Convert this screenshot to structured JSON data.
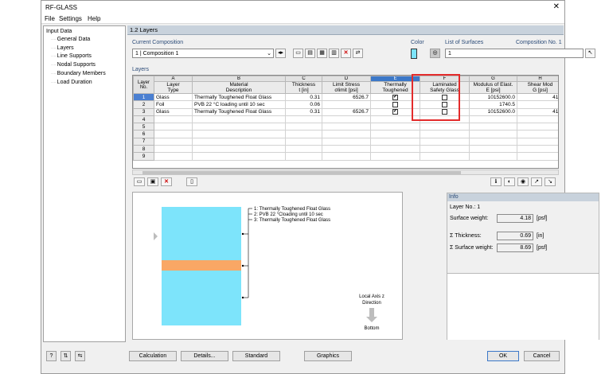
{
  "window": {
    "title": "RF-GLASS",
    "close": "✕"
  },
  "menu": {
    "file": "File",
    "settings": "Settings",
    "help": "Help"
  },
  "nav": {
    "root": "Input Data",
    "items": [
      "General Data",
      "Layers",
      "Line Supports",
      "Nodal Supports",
      "Boundary Members",
      "Load Duration"
    ]
  },
  "section_title": "1.2 Layers",
  "composition": {
    "label": "Current Composition",
    "value": "1 | Composition 1"
  },
  "color": {
    "label": "Color"
  },
  "surfaces": {
    "label": "List of Surfaces",
    "value": "1",
    "composition_no": "Composition No. 1"
  },
  "layers_label": "Layers",
  "grid": {
    "letters": [
      "A",
      "B",
      "C",
      "D",
      "E",
      "F",
      "G",
      "H"
    ],
    "headers": {
      "layer": [
        "Layer",
        "No."
      ],
      "a": [
        "Layer",
        "Type"
      ],
      "b": [
        "Material",
        "Description"
      ],
      "c": [
        "Thickness",
        "t [in]"
      ],
      "d": [
        "Limit Stress",
        "σlimit [psi]"
      ],
      "e": [
        "Thermally",
        "Toughened"
      ],
      "f": [
        "Laminated",
        "Safety Glass"
      ],
      "g": [
        "Modulus of Elast.",
        "E [psi]"
      ],
      "h": [
        "Shear Mod",
        "G [psi]"
      ]
    },
    "rows": [
      {
        "no": "1",
        "type": "Glass",
        "material": "Thermally Toughened Float Glass",
        "t": "0.31",
        "s": "6526.7",
        "tt": "✔",
        "lsg": "",
        "e": "10152600.0",
        "g": "412"
      },
      {
        "no": "2",
        "type": "Foil",
        "material": "PVB 22 °C loading until 10 sec",
        "t": "0.06",
        "s": "",
        "tt": "",
        "lsg": "",
        "e": "1740.5",
        "g": ""
      },
      {
        "no": "3",
        "type": "Glass",
        "material": "Thermally Toughened Float Glass",
        "t": "0.31",
        "s": "6526.7",
        "tt": "✔",
        "lsg": "",
        "e": "10152600.0",
        "g": "412"
      },
      {
        "no": "4"
      },
      {
        "no": "5"
      },
      {
        "no": "6"
      },
      {
        "no": "7"
      },
      {
        "no": "8"
      },
      {
        "no": "9"
      }
    ]
  },
  "graphic": {
    "legend": [
      "1: Thermally Toughened Float Glass",
      "2: PVB 22 °Cloading until 10 sec",
      "3: Thermally Toughened Float Glass"
    ],
    "axis": [
      "Local Axis z",
      "Direction"
    ],
    "bottom": "Bottom",
    "colors": {
      "glass": "#7de4fb",
      "foil": "#f9a765"
    }
  },
  "info": {
    "title": "Info",
    "layer_no": "Layer No.: 1",
    "surface_weight_label": "Surface weight:",
    "surface_weight": "4.18",
    "surface_weight_unit": "[psf]",
    "thickness_label": "Σ Thickness:",
    "thickness": "0.69",
    "thickness_unit": "[in]",
    "total_weight_label": "Σ Surface weight:",
    "total_weight": "8.69",
    "total_weight_unit": "[psf]"
  },
  "footer": {
    "calculation": "Calculation",
    "details": "Details...",
    "standard": "Standard",
    "graphics": "Graphics",
    "ok": "OK",
    "cancel": "Cancel"
  }
}
